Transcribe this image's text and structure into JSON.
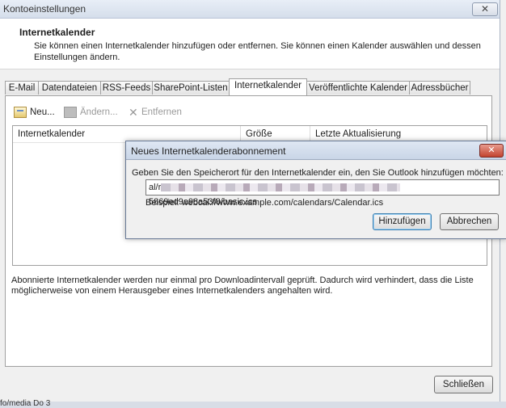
{
  "window": {
    "title": "Kontoeinstellungen",
    "close_glyph": "✕"
  },
  "header": {
    "title": "Internetkalender",
    "description": "Sie können einen Internetkalender hinzufügen oder entfernen. Sie können einen Kalender auswählen und dessen Einstellungen ändern."
  },
  "tabs": [
    {
      "label": "E-Mail"
    },
    {
      "label": "Datendateien"
    },
    {
      "label": "RSS-Feeds"
    },
    {
      "label": "SharePoint-Listen"
    },
    {
      "label": "Internetkalender"
    },
    {
      "label": "Veröffentlichte Kalender"
    },
    {
      "label": "Adressbücher"
    }
  ],
  "active_tab": "Internetkalender",
  "toolbar": {
    "new_label": "Neu...",
    "change_label": "Ändern...",
    "remove_label": "Entfernen",
    "new_icon": "new-calendar-icon",
    "change_icon": "change-icon",
    "remove_icon": "remove-x-icon"
  },
  "list": {
    "columns": [
      "Internetkalender",
      "Größe",
      "Letzte Aktualisierung"
    ]
  },
  "note": "Abonnierte Internetkalender werden nur einmal pro Downloadintervall geprüft. Dadurch wird verhindert, dass die Liste möglicherweise von einem Herausgeber eines Internetkalenders angehalten wird.",
  "close_button": "Schließen",
  "statusbar": {
    "left_text": "fo/media Do 3"
  },
  "dialog": {
    "title": "Neues Internetkalenderabonnement",
    "close_glyph": "✕",
    "prompt": "Geben Sie den Speicherort für den Internetkalender ein, den Sie Outlook hinzufügen möchten:",
    "input_value": "al/r",
    "input_suffix": "5869ed9a98a53f8/basic.ics",
    "example": "Beispiel: webcal://www.example.com/calendars/Calendar.ics",
    "add_button": "Hinzufügen",
    "cancel_button": "Abbrechen"
  }
}
